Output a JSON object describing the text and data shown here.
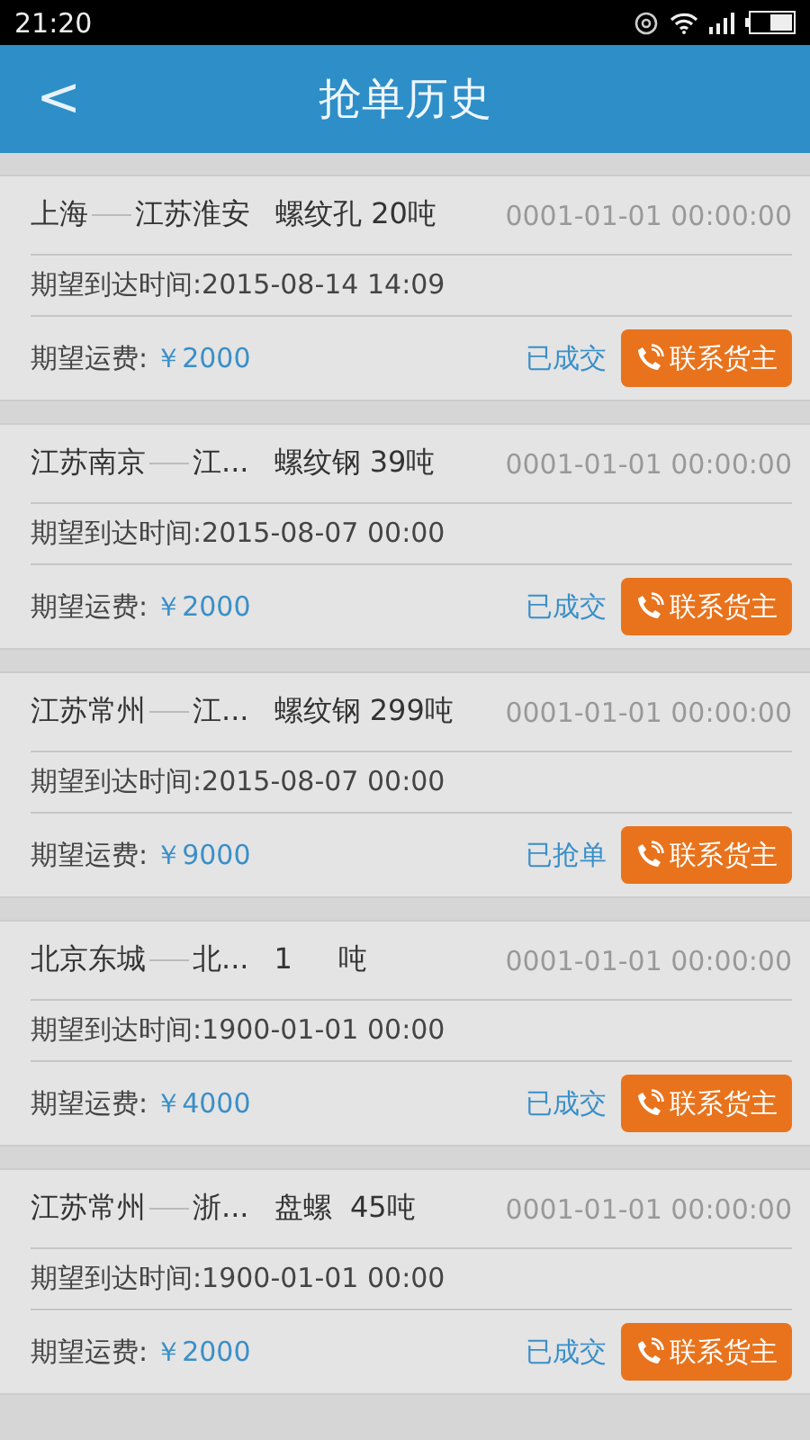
{
  "status_bar": {
    "time": "21:20"
  },
  "header": {
    "back": "<",
    "title": "抢单历史"
  },
  "orders": [
    {
      "from": "上海",
      "to": "江苏淮安",
      "goods": "螺纹孔 20吨",
      "posted": "0001-01-01 00:00:00",
      "arrival": "期望到达时间:2015-08-14 14:09",
      "fee_label": "期望运费:",
      "fee": "￥2000",
      "status": "已成交",
      "contact": "联系货主"
    },
    {
      "from": "江苏南京",
      "to": "江...",
      "goods": "螺纹钢 39吨",
      "posted": "0001-01-01 00:00:00",
      "arrival": "期望到达时间:2015-08-07 00:00",
      "fee_label": "期望运费:",
      "fee": "￥2000",
      "status": "已成交",
      "contact": "联系货主"
    },
    {
      "from": "江苏常州",
      "to": "江...",
      "goods": "螺纹钢 299吨",
      "posted": "0001-01-01 00:00:00",
      "arrival": "期望到达时间:2015-08-07 00:00",
      "fee_label": "期望运费:",
      "fee": "￥9000",
      "status": "已抢单",
      "contact": "联系货主"
    },
    {
      "from": "北京东城",
      "to": "北...",
      "goods": "1     吨",
      "posted": "0001-01-01 00:00:00",
      "arrival": "期望到达时间:1900-01-01 00:00",
      "fee_label": "期望运费:",
      "fee": "￥4000",
      "status": "已成交",
      "contact": "联系货主"
    },
    {
      "from": "江苏常州",
      "to": "浙...",
      "goods": "盘螺  45吨",
      "posted": "0001-01-01 00:00:00",
      "arrival": "期望到达时间:1900-01-01 00:00",
      "fee_label": "期望运费:",
      "fee": "￥2000",
      "status": "已成交",
      "contact": "联系货主"
    }
  ]
}
